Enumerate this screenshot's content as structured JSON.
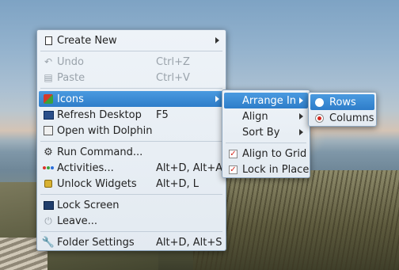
{
  "main_menu": {
    "items": [
      {
        "label": "Create New",
        "icon": "new-document-icon",
        "shortcut": "",
        "submenu": true,
        "disabled": false
      },
      {
        "label": "Undo",
        "icon": "undo-icon",
        "shortcut": "Ctrl+Z",
        "submenu": false,
        "disabled": true
      },
      {
        "label": "Paste",
        "icon": "paste-icon",
        "shortcut": "Ctrl+V",
        "submenu": false,
        "disabled": true
      },
      {
        "label": "Icons",
        "icon": "icons-icon",
        "shortcut": "",
        "submenu": true,
        "disabled": false,
        "highlighted": true
      },
      {
        "label": "Refresh Desktop",
        "icon": "refresh-icon",
        "shortcut": "F5",
        "submenu": false,
        "disabled": false
      },
      {
        "label": "Open with Dolphin",
        "icon": "dolphin-icon",
        "shortcut": "",
        "submenu": false,
        "disabled": false
      },
      {
        "label": "Run Command...",
        "icon": "run-command-icon",
        "shortcut": "",
        "submenu": false,
        "disabled": false
      },
      {
        "label": "Activities...",
        "icon": "activities-icon",
        "shortcut": "Alt+D, Alt+A",
        "submenu": false,
        "disabled": false
      },
      {
        "label": "Unlock Widgets",
        "icon": "lock-icon",
        "shortcut": "Alt+D, L",
        "submenu": false,
        "disabled": false
      },
      {
        "label": "Lock Screen",
        "icon": "lock-screen-icon",
        "shortcut": "",
        "submenu": false,
        "disabled": false
      },
      {
        "label": "Leave...",
        "icon": "leave-icon",
        "shortcut": "",
        "submenu": false,
        "disabled": false
      },
      {
        "label": "Folder Settings",
        "icon": "wrench-icon",
        "shortcut": "Alt+D, Alt+S",
        "submenu": false,
        "disabled": false
      }
    ]
  },
  "icons_submenu": {
    "items": [
      {
        "label": "Arrange In",
        "submenu": true,
        "highlighted": true
      },
      {
        "label": "Align",
        "submenu": true
      },
      {
        "label": "Sort By",
        "submenu": true
      },
      {
        "label": "Align to Grid",
        "checked": true
      },
      {
        "label": "Lock in Place",
        "checked": true
      }
    ]
  },
  "arrange_submenu": {
    "items": [
      {
        "label": "Rows",
        "selected": false,
        "highlighted": true
      },
      {
        "label": "Columns",
        "selected": true
      }
    ]
  },
  "colors": {
    "highlight": "#2e7dc9",
    "check_mark": "#d2281e",
    "menu_background": "#eef3f8"
  }
}
